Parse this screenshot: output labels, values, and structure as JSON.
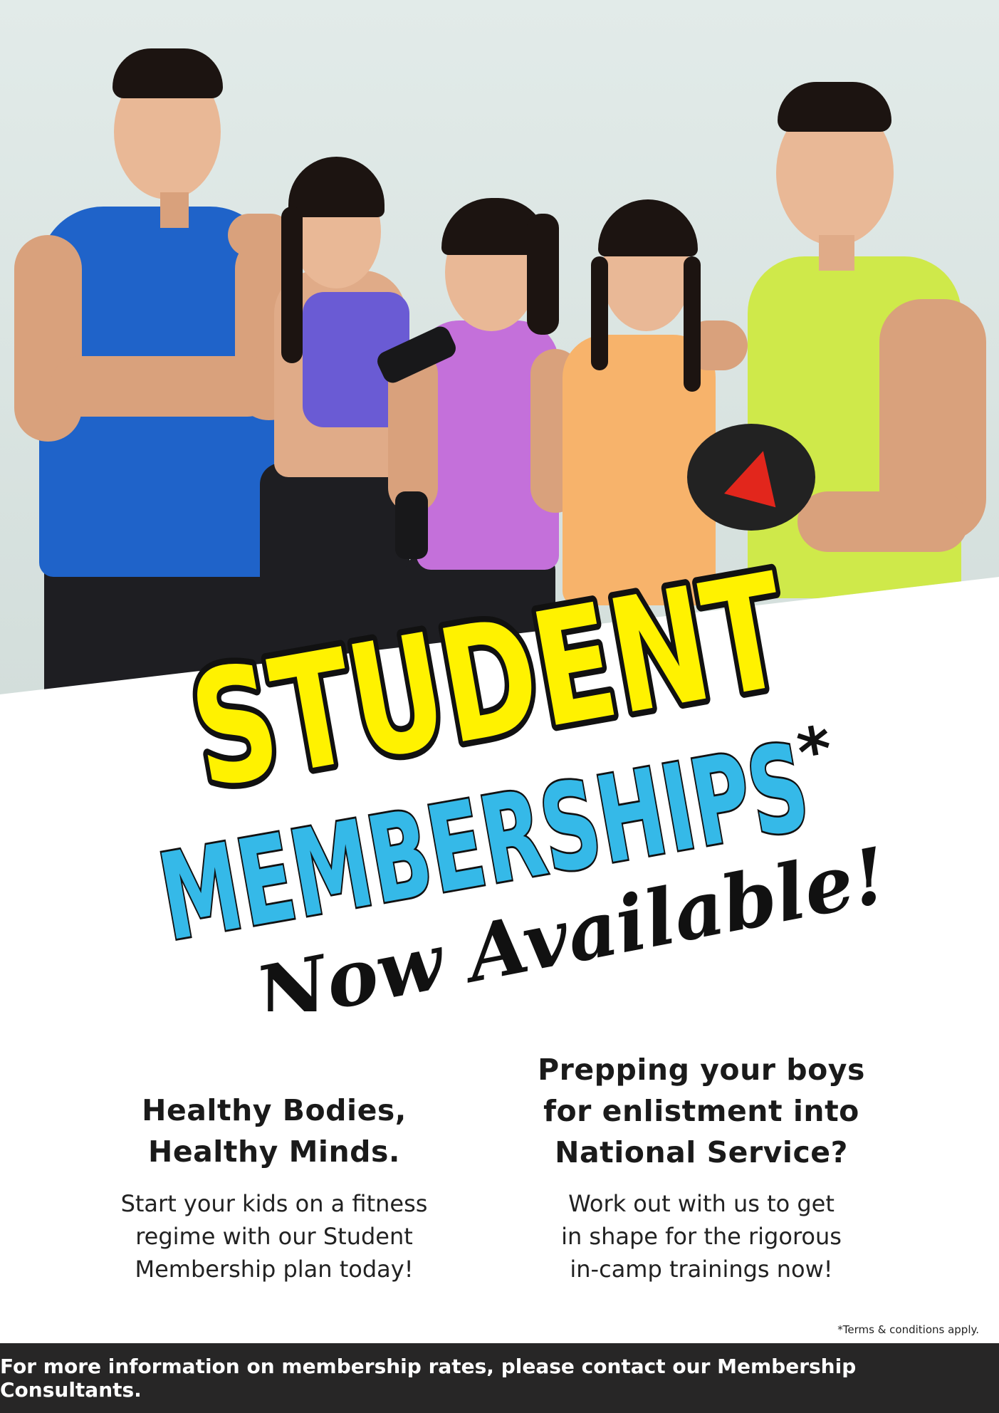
{
  "headline": {
    "line1": "STUDENT",
    "line2": "MEMBERSHIPS",
    "asterisk": "*",
    "script": "Now Available!"
  },
  "left_column": {
    "heading_line1": "Healthy Bodies,",
    "heading_line2": "Healthy Minds.",
    "body_line1": "Start your kids on a fitness",
    "body_line2": "regime with our Student",
    "body_line3": "Membership plan today!"
  },
  "right_column": {
    "heading_line1": "Prepping your boys",
    "heading_line2": "for enlistment into",
    "heading_line3": "National Service?",
    "body_line1": "Work out with us to get",
    "body_line2": "in shape for the rigorous",
    "body_line3": "in-camp trainings now!"
  },
  "terms": "*Terms & conditions apply.",
  "footer": "For more information on membership rates, please contact our Membership Consultants.",
  "colors": {
    "yellow": "#fff200",
    "blue": "#35b9e8",
    "black": "#111111",
    "footer_bg": "#272626"
  },
  "photo": {
    "description_icons": [
      "dumbbell-icon"
    ]
  }
}
